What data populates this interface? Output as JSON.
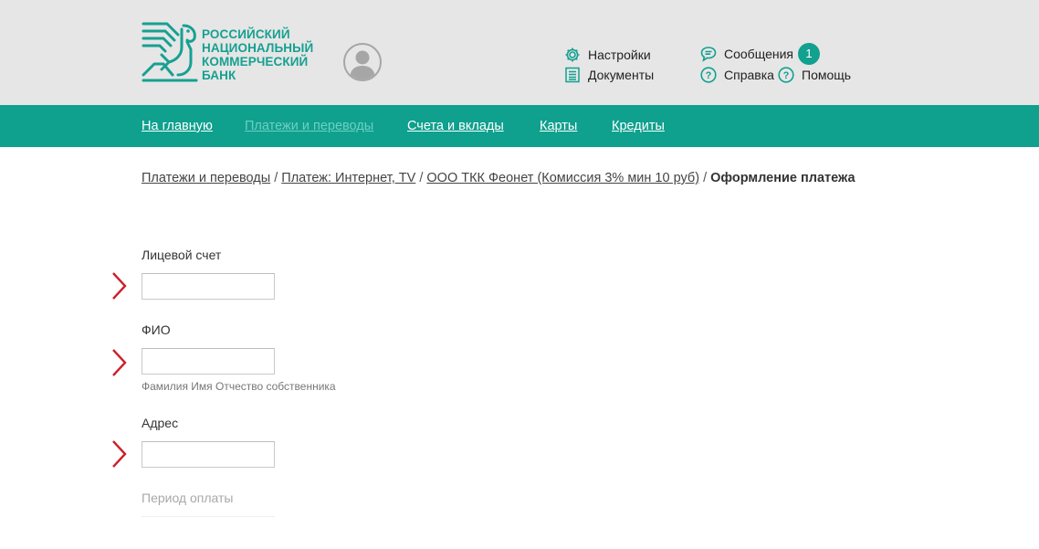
{
  "header": {
    "logo_lines": [
      "РОССИЙСКИЙ",
      "НАЦИОНАЛЬНЫЙ",
      "КОММЕРЧЕСКИЙ",
      "БАНК"
    ],
    "brand_color": "#16a091",
    "links": {
      "settings": "Настройки",
      "documents": "Документы",
      "messages": "Сообщения",
      "messages_count": "1",
      "reference": "Справка",
      "help": "Помощь"
    },
    "icons": {
      "settings": "gear-icon",
      "documents": "document-icon",
      "messages": "chat-bubble-icon",
      "reference": "question-circle-icon",
      "help": "question-circle-icon",
      "avatar": "user-avatar-icon"
    }
  },
  "nav": {
    "color": "#0fa08e",
    "items": [
      {
        "label": "На главную",
        "active": false
      },
      {
        "label": "Платежи и переводы",
        "active": true
      },
      {
        "label": "Счета и вклады",
        "active": false
      },
      {
        "label": "Карты",
        "active": false
      },
      {
        "label": "Кредиты",
        "active": false
      }
    ]
  },
  "breadcrumb": {
    "items": [
      "Платежи и переводы",
      "Платеж: Интернет, TV",
      "ООО ТКК Феонет (Комиссия 3% мин 10 руб)"
    ],
    "separator": "/",
    "current": "Оформление платежа"
  },
  "form": {
    "account": {
      "label": "Лицевой счет",
      "value": ""
    },
    "fio": {
      "label": "ФИО",
      "value": "",
      "hint": "Фамилия Имя Отчество собственника"
    },
    "address": {
      "label": "Адрес",
      "value": ""
    },
    "period": {
      "label": "Период оплаты"
    },
    "required_marker_color": "#cc1f2a"
  }
}
